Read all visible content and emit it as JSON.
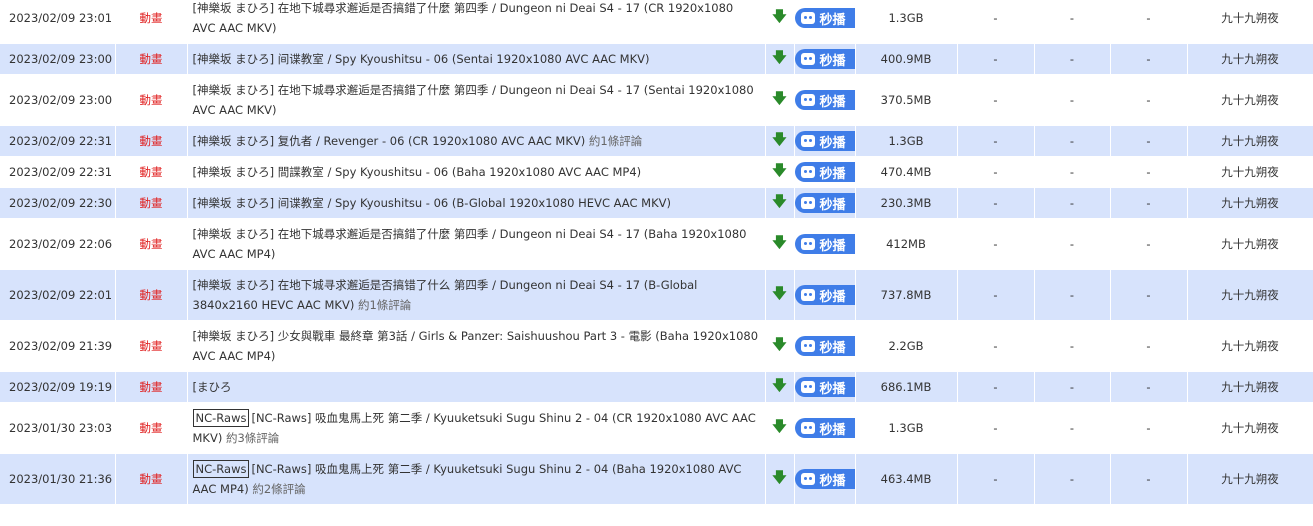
{
  "download_icon": "down-arrow-icon",
  "magnet_icon": "robot-icon",
  "rows": [
    {
      "date": "2023/02/09 23:01",
      "category": "動畫",
      "tag": "",
      "title": "[神樂坂 まひろ] 在地下城尋求邂逅是否搞錯了什麼 第四季 / Dungeon ni Deai S4 - 17 (CR 1920x1080 AVC AAC MKV)",
      "comments": "",
      "magnet": "秒播",
      "size": "1.3GB",
      "seeds": "-",
      "leech": "-",
      "done": "-",
      "uploader": "九十九朔夜"
    },
    {
      "date": "2023/02/09 23:00",
      "category": "動畫",
      "tag": "",
      "title": "[神樂坂 まひろ] 间谍教室 / Spy Kyoushitsu - 06 (Sentai 1920x1080 AVC AAC MKV)",
      "comments": "",
      "magnet": "秒播",
      "size": "400.9MB",
      "seeds": "-",
      "leech": "-",
      "done": "-",
      "uploader": "九十九朔夜"
    },
    {
      "date": "2023/02/09 23:00",
      "category": "動畫",
      "tag": "",
      "title": "[神樂坂 まひろ] 在地下城尋求邂逅是否搞錯了什麼 第四季 / Dungeon ni Deai S4 - 17 (Sentai 1920x1080 AVC AAC MKV)",
      "comments": "",
      "magnet": "秒播",
      "size": "370.5MB",
      "seeds": "-",
      "leech": "-",
      "done": "-",
      "uploader": "九十九朔夜"
    },
    {
      "date": "2023/02/09 22:31",
      "category": "動畫",
      "tag": "",
      "title": "[神樂坂 まひろ] 复仇者 / Revenger - 06 (CR 1920x1080 AVC AAC MKV)",
      "comments": "約1條評論",
      "magnet": "秒播",
      "size": "1.3GB",
      "seeds": "-",
      "leech": "-",
      "done": "-",
      "uploader": "九十九朔夜"
    },
    {
      "date": "2023/02/09 22:31",
      "category": "動畫",
      "tag": "",
      "title": "[神樂坂 まひろ] 間諜教室 / Spy Kyoushitsu - 06 (Baha 1920x1080 AVC AAC MP4)",
      "comments": "",
      "magnet": "秒播",
      "size": "470.4MB",
      "seeds": "-",
      "leech": "-",
      "done": "-",
      "uploader": "九十九朔夜"
    },
    {
      "date": "2023/02/09 22:30",
      "category": "動畫",
      "tag": "",
      "title": "[神樂坂 まひろ] 间谍教室 / Spy Kyoushitsu - 06 (B-Global 1920x1080 HEVC AAC MKV)",
      "comments": "",
      "magnet": "秒播",
      "size": "230.3MB",
      "seeds": "-",
      "leech": "-",
      "done": "-",
      "uploader": "九十九朔夜"
    },
    {
      "date": "2023/02/09 22:06",
      "category": "動畫",
      "tag": "",
      "title": "[神樂坂 まひろ] 在地下城尋求邂逅是否搞錯了什麼 第四季 / Dungeon ni Deai S4 - 17 (Baha 1920x1080 AVC AAC MP4)",
      "comments": "",
      "magnet": "秒播",
      "size": "412MB",
      "seeds": "-",
      "leech": "-",
      "done": "-",
      "uploader": "九十九朔夜"
    },
    {
      "date": "2023/02/09 22:01",
      "category": "動畫",
      "tag": "",
      "title": "[神樂坂 まひろ] 在地下城寻求邂逅是否搞错了什么 第四季 / Dungeon ni Deai S4 - 17 (B-Global 3840x2160 HEVC AAC MKV)",
      "comments": "約1條評論",
      "magnet": "秒播",
      "size": "737.8MB",
      "seeds": "-",
      "leech": "-",
      "done": "-",
      "uploader": "九十九朔夜"
    },
    {
      "date": "2023/02/09 21:39",
      "category": "動畫",
      "tag": "",
      "title": "[神樂坂 まひろ] 少女與戰車 最終章 第3話 / Girls & Panzer: Saishuushou Part 3 - 電影 (Baha 1920x1080 AVC AAC MP4)",
      "comments": "",
      "magnet": "秒播",
      "size": "2.2GB",
      "seeds": "-",
      "leech": "-",
      "done": "-",
      "uploader": "九十九朔夜"
    },
    {
      "date": "2023/02/09 19:19",
      "category": "動畫",
      "tag": "",
      "title": "[まひろ",
      "comments": "",
      "magnet": "秒播",
      "size": "686.1MB",
      "seeds": "-",
      "leech": "-",
      "done": "-",
      "uploader": "九十九朔夜"
    },
    {
      "date": "2023/01/30 23:03",
      "category": "動畫",
      "tag": "NC-Raws",
      "title": "[NC-Raws] 吸血鬼馬上死 第二季 / Kyuuketsuki Sugu Shinu 2 - 04 (CR 1920x1080 AVC AAC MKV)",
      "comments": "約3條評論",
      "magnet": "秒播",
      "size": "1.3GB",
      "seeds": "-",
      "leech": "-",
      "done": "-",
      "uploader": "九十九朔夜"
    },
    {
      "date": "2023/01/30 21:36",
      "category": "動畫",
      "tag": "NC-Raws",
      "title": "[NC-Raws] 吸血鬼馬上死 第二季 / Kyuuketsuki Sugu Shinu 2 - 04 (Baha 1920x1080 AVC AAC MP4)",
      "comments": "約2條評論",
      "magnet": "秒播",
      "size": "463.4MB",
      "seeds": "-",
      "leech": "-",
      "done": "-",
      "uploader": "九十九朔夜"
    }
  ]
}
